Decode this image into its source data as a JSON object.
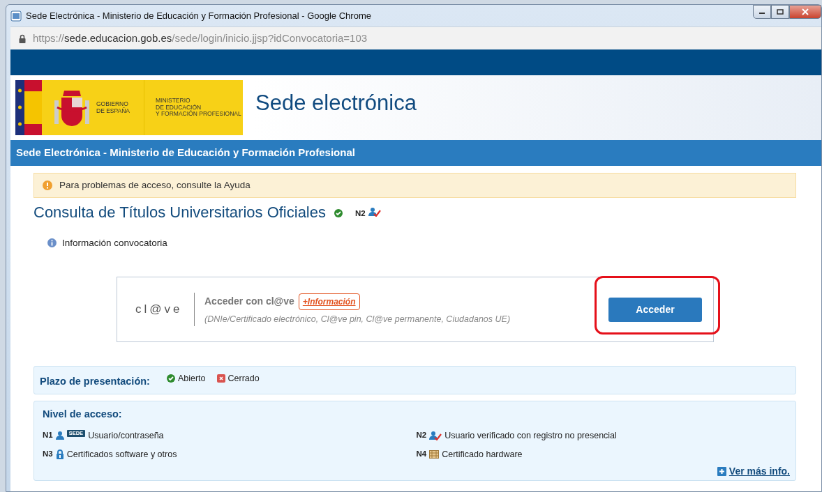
{
  "window": {
    "title": "Sede Electrónica - Ministerio de Educación y Formación Profesional - Google Chrome"
  },
  "address": {
    "scheme": "https://",
    "host": "sede.educacion.gob.es",
    "path": "/sede/login/inicio.jjsp?idConvocatoria=103"
  },
  "header": {
    "logo_lines_left": [
      "GOBIERNO",
      "DE ESPAÑA"
    ],
    "logo_lines_right": [
      "MINISTERIO",
      "DE EDUCACIÓN",
      "Y FORMACIÓN PROFESIONAL"
    ],
    "title": "Sede electrónica"
  },
  "section_bar": "Sede Electrónica - Ministerio de Educación y Formación Profesional",
  "alert": "Para problemas de acceso, consulte la Ayuda",
  "page_title": {
    "text": "Consulta de Títulos Universitarios Oficiales",
    "open": true,
    "level": "N2"
  },
  "info_link": "Información convocatoria",
  "login": {
    "logo": "cl@ve",
    "heading": "Acceder con cl@ve",
    "more": "+Información",
    "methods": "(DNIe/Certificado electrónico, Cl@ve pin, Cl@ve permanente, Ciudadanos UE)",
    "button": "Acceder",
    "highlighted": true
  },
  "deadline": {
    "label": "Plazo de presentación:",
    "legend": [
      {
        "kind": "open",
        "label": "Abierto"
      },
      {
        "kind": "closed",
        "label": "Cerrado"
      }
    ]
  },
  "access": {
    "label": "Nivel de acceso:",
    "levels": [
      {
        "code": "N1",
        "kind": "user-sede",
        "badge": "SEDE",
        "label": "Usuario/contraseña"
      },
      {
        "code": "N2",
        "kind": "user-check",
        "label": "Usuario verificado con registro no presencial"
      },
      {
        "code": "N3",
        "kind": "lock",
        "label": "Certificados software y otros"
      },
      {
        "code": "N4",
        "kind": "chip",
        "label": "Certificado hardware"
      }
    ],
    "more": "Ver más info."
  }
}
